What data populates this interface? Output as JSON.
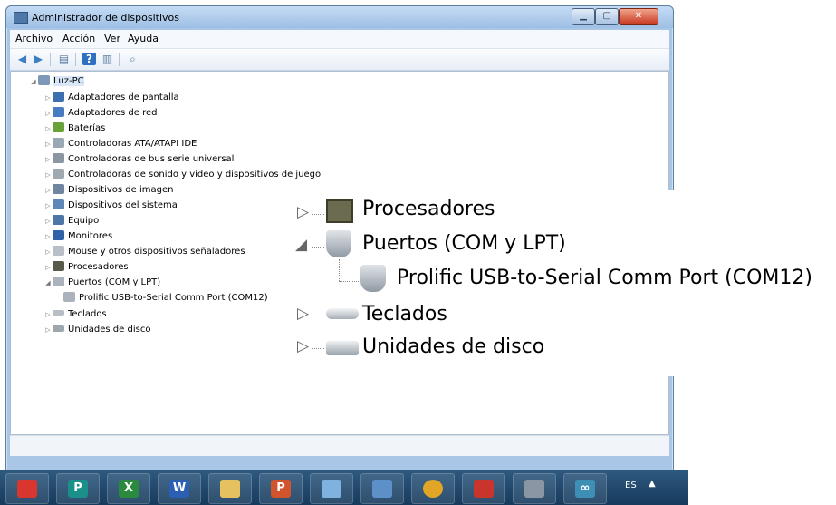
{
  "window": {
    "title": "Administrador de dispositivos",
    "minimize": "▁",
    "maximize": "▢",
    "close": "✕"
  },
  "menu": {
    "items": [
      "Archivo",
      "Acción",
      "Ver",
      "Ayuda"
    ]
  },
  "tree": {
    "root": "Luz-PC",
    "items": [
      "Adaptadores de pantalla",
      "Adaptadores de red",
      "Baterías",
      "Controladoras ATA/ATAPI IDE",
      "Controladoras de bus serie universal",
      "Controladoras de sonido y vídeo y dispositivos de juego",
      "Dispositivos de imagen",
      "Dispositivos del sistema",
      "Equipo",
      "Monitores",
      "Mouse y otros dispositivos señaladores",
      "Procesadores",
      "Puertos (COM y LPT)",
      "Prolific USB-to-Serial Comm Port (COM12)",
      "Teclados",
      "Unidades de disco"
    ]
  },
  "zoom": {
    "items": [
      "Procesadores",
      "Puertos (COM y LPT)",
      "Prolific USB-to-Serial Comm Port (COM12)",
      "Teclados",
      "Unidades de disco"
    ]
  },
  "taskbar": {
    "apps": [
      {
        "icon": "toolbox-icon",
        "glyph": "",
        "color": "#d9362f"
      },
      {
        "icon": "publisher-icon",
        "glyph": "P",
        "color": "#1b8f8a"
      },
      {
        "icon": "excel-icon",
        "glyph": "X",
        "color": "#2b8a3e"
      },
      {
        "icon": "word-icon",
        "glyph": "W",
        "color": "#2b5fb4"
      },
      {
        "icon": "folder-icon",
        "glyph": "",
        "color": "#e6c160"
      },
      {
        "icon": "powerpoint-icon",
        "glyph": "P",
        "color": "#d2542c"
      },
      {
        "icon": "notepad-icon",
        "glyph": "",
        "color": "#7fb2de"
      },
      {
        "icon": "pen-icon",
        "glyph": "",
        "color": "#5d8fc8"
      },
      {
        "icon": "chrome-icon",
        "glyph": "",
        "color": "#e2a626"
      },
      {
        "icon": "microchip-icon",
        "glyph": "",
        "color": "#c9342c"
      },
      {
        "icon": "device-manager-icon",
        "glyph": "",
        "color": "#8a96a3"
      },
      {
        "icon": "arduino-icon",
        "glyph": "∞",
        "color": "#3d8fb6"
      }
    ],
    "language": "ES",
    "tray_arrow": "▲"
  }
}
